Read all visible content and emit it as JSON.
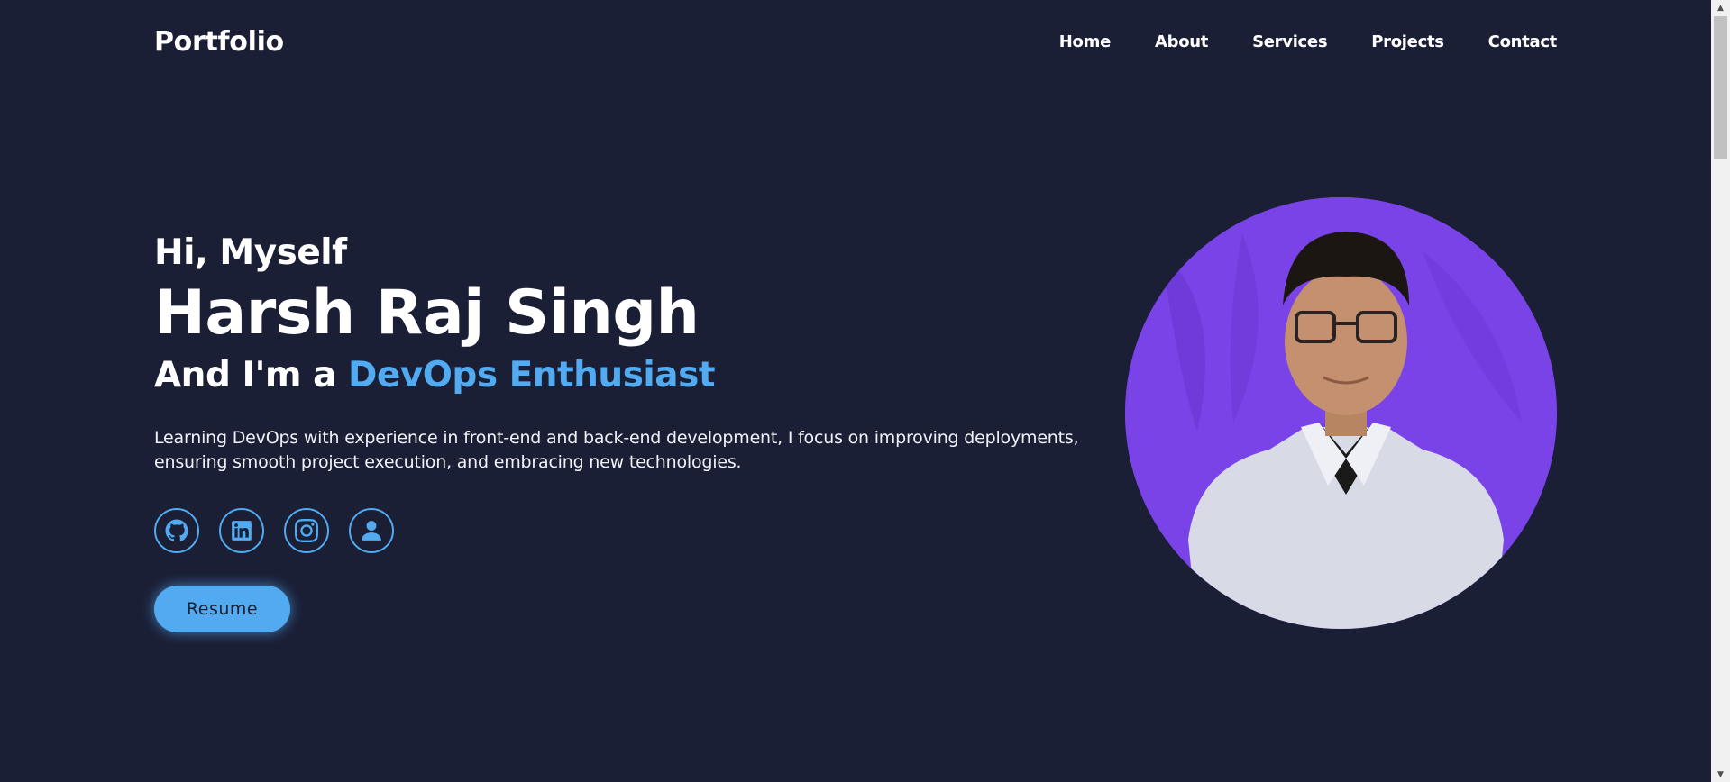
{
  "header": {
    "logo": "Portfolio",
    "nav": [
      "Home",
      "About",
      "Services",
      "Projects",
      "Contact"
    ]
  },
  "hero": {
    "greeting": "Hi, Myself",
    "name": "Harsh Raj Singh",
    "role_prefix": "And I'm a ",
    "role_accent": "DevOps Enthusiast",
    "description": "Learning DevOps with experience in front-end and back-end development, I focus on improving deployments, ensuring smooth project execution, and embracing new technologies.",
    "socials": [
      "github-icon",
      "linkedin-icon",
      "instagram-icon",
      "user-icon"
    ],
    "resume_label": "Resume"
  },
  "colors": {
    "background": "#1b1f36",
    "accent": "#52abf0",
    "photo_bg": "#7a43e8"
  }
}
